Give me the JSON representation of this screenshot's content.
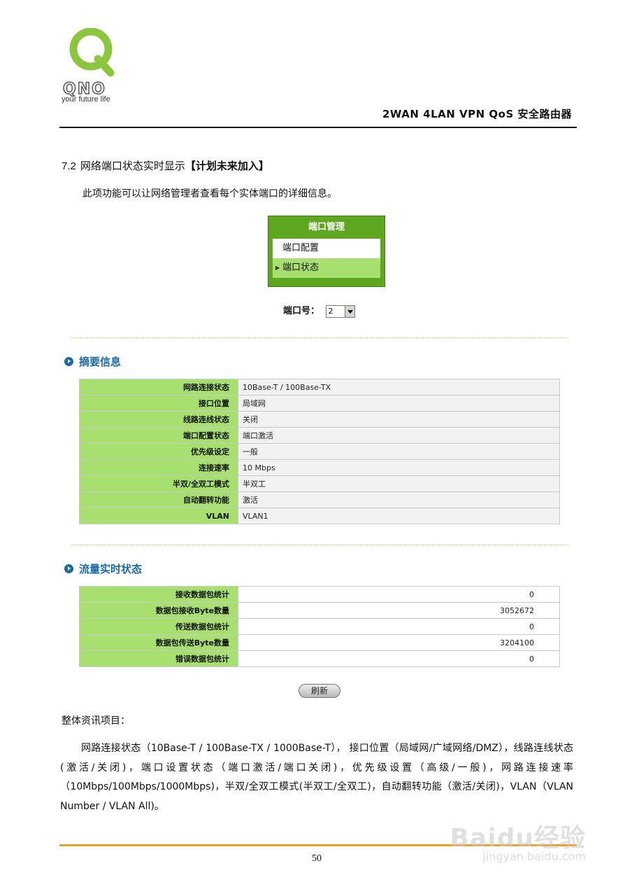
{
  "header": {
    "logo_brand": "QNO",
    "tagline": "your future life",
    "product_title": "2WAN 4LAN VPN QoS 安全路由器"
  },
  "section": {
    "number": "7.2",
    "title": "网络端口状态实时显示",
    "note": "【计划未来加入】",
    "intro": "此项功能可以让网络管理者查看每个实体端口的详细信息。"
  },
  "menu": {
    "title": "端口管理",
    "items": [
      {
        "label": "端口配置"
      },
      {
        "label": "端口状态"
      }
    ]
  },
  "port_selector": {
    "label": "端口号：",
    "value": "2"
  },
  "summary": {
    "heading": "摘要信息",
    "rows": [
      {
        "label": "网路连接状态",
        "value": "10Base-T / 100Base-TX"
      },
      {
        "label": "接口位置",
        "value": "局域网"
      },
      {
        "label": "线路连线状态",
        "value": "关闭"
      },
      {
        "label": "端口配置状态",
        "value": "端口激活"
      },
      {
        "label": "优先级设定",
        "value": "一般"
      },
      {
        "label": "连接速率",
        "value": "10 Mbps"
      },
      {
        "label": "半双/全双工模式",
        "value": "半双工"
      },
      {
        "label": "自动翻转功能",
        "value": "激活"
      },
      {
        "label": "VLAN",
        "value": "VLAN1"
      }
    ]
  },
  "traffic": {
    "heading": "流量实时状态",
    "rows": [
      {
        "label": "接收数据包统计",
        "value": "0"
      },
      {
        "label": "数据包接收Byte数量",
        "value": "3052672"
      },
      {
        "label": "传送数据包统计",
        "value": "0"
      },
      {
        "label": "数据包传送Byte数量",
        "value": "3204100"
      },
      {
        "label": "错误数据包统计",
        "value": "0"
      }
    ]
  },
  "refresh_label": "刷新",
  "overall_label": "整体资讯项目：",
  "body_text": "网路连接状态（10Base-T / 100Base-TX / 1000Base-T）， 接口位置（局域网/广域网络/DMZ），线路连线状态(激活/关闭)，端口设置状态（端口激活/端口关闭)，优先级设置（高级/一般)，网路连接速率（10Mbps/100Mbps/1000Mbps)，半双/全双工模式(半双工/全双工)，自动翻转功能（激活/关闭)，VLAN（VLAN Number / VLAN All)。",
  "footer": {
    "page_number": "50"
  },
  "watermark": {
    "brand": "Baidu经验",
    "url": "jingyan.baidu.com"
  },
  "colors": {
    "brand_green": "#8cc63f",
    "table_label_green": "#a8e070",
    "heading_blue": "#1a6aa8",
    "footer_orange": "#f0a020"
  }
}
